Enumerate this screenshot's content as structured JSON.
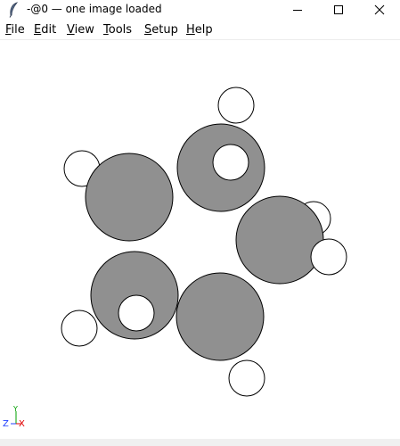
{
  "window": {
    "title": "-@0 — one image loaded",
    "icon": "feather-icon",
    "controls": [
      "minimize-icon",
      "maximize-icon",
      "close-icon"
    ]
  },
  "menu": {
    "items": [
      {
        "label": "File",
        "key": "F",
        "rest": "ile"
      },
      {
        "label": "Edit",
        "key": "E",
        "rest": "dit"
      },
      {
        "label": "View",
        "key": "V",
        "rest": "iew"
      },
      {
        "label": "Tools",
        "key": "T",
        "rest": "ools"
      },
      {
        "label": "Setup",
        "key": "S",
        "rest": "etup"
      },
      {
        "label": "Help",
        "key": "H",
        "rest": "elp"
      }
    ]
  },
  "axes": {
    "z_label": "Z",
    "y_label": "Y",
    "x_label": "X",
    "y_color": "#00a000",
    "x_color": "#e00000"
  },
  "colors": {
    "carbon": "#909090",
    "hydrogen": "#ffffff",
    "outline": "#000000"
  }
}
